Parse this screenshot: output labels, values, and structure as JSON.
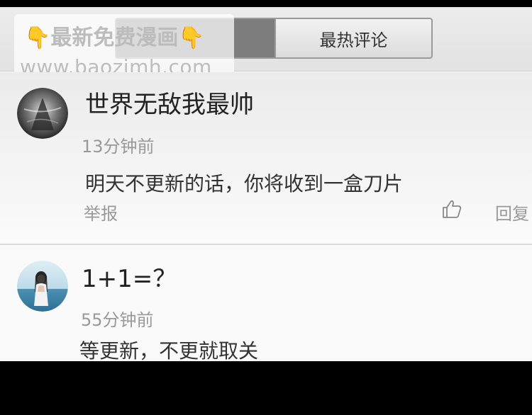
{
  "tabs": [
    {
      "label": ""
    },
    {
      "label": "最热评论"
    }
  ],
  "watermark": {
    "line1": "最新免费漫画",
    "line2": "www.baozimh.com"
  },
  "comments": [
    {
      "username": "世界无敌我最帅",
      "time": "13分钟前",
      "text": "明天不更新的话，你将收到一盒刀片",
      "report": "举报",
      "reply": "回复"
    },
    {
      "username": "1+1=？",
      "time": "55分钟前",
      "text": "等更新，不更就取关"
    }
  ],
  "colors": {
    "background": "#fafafa",
    "tab_active": "#7d7d7d",
    "muted_text": "#999999",
    "watermark_hand": "#f5a623"
  }
}
